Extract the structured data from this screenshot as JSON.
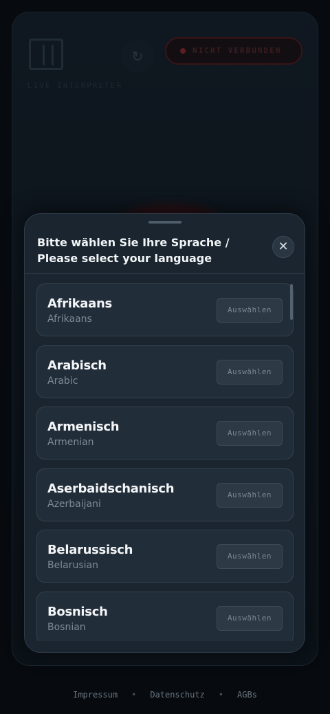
{
  "app": {
    "logo_text": "LIVE INTERPRETER",
    "status": "NICHT VERBUNDEN"
  },
  "modal": {
    "title": "Bitte wählen Sie Ihre Sprache / Please select your language",
    "languages": [
      {
        "name": "Afrikaans",
        "english": "Afrikaans",
        "button": "Auswählen"
      },
      {
        "name": "Arabisch",
        "english": "Arabic",
        "button": "Auswählen"
      },
      {
        "name": "Armenisch",
        "english": "Armenian",
        "button": "Auswählen"
      },
      {
        "name": "Aserbaidschanisch",
        "english": "Azerbaijani",
        "button": "Auswählen"
      },
      {
        "name": "Belarussisch",
        "english": "Belarusian",
        "button": "Auswählen"
      },
      {
        "name": "Bosnisch",
        "english": "Bosnian",
        "button": "Auswählen"
      }
    ]
  },
  "footer": {
    "links": [
      "Impressum",
      "Datenschutz",
      "AGBs"
    ],
    "separator": "•"
  },
  "colors": {
    "background": "#070b0f",
    "modal": "#1a252f",
    "status_red": "#5e1d22"
  }
}
